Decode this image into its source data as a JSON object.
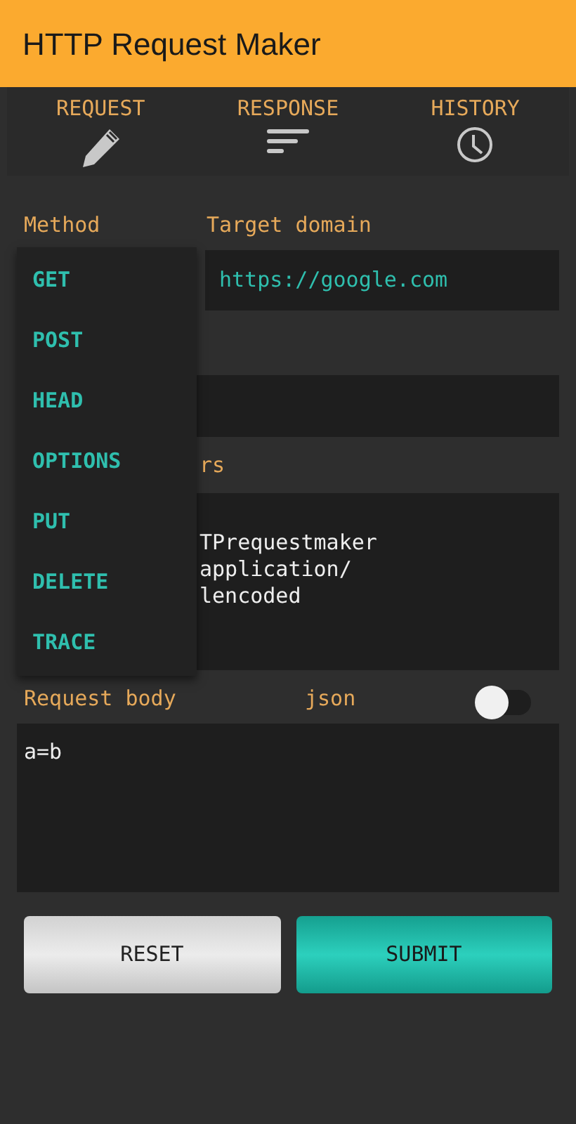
{
  "app_bar": {
    "title": "HTTP Request Maker"
  },
  "tabs": [
    {
      "label": "REQUEST",
      "kind": "pencil"
    },
    {
      "label": "RESPONSE",
      "kind": "lines"
    },
    {
      "label": "HISTORY",
      "kind": "clock"
    }
  ],
  "form": {
    "method_label": "Method",
    "domain_label": "Target domain",
    "domain_value": "https://google.com",
    "headers_label_partial": "rs",
    "headers_value_partial": [
      "TPrequestmaker",
      "application/",
      "lencoded"
    ],
    "body_label": "Request body",
    "json_label": "json",
    "json_on": false,
    "body_value": "a=b"
  },
  "method_menu": [
    "GET",
    "POST",
    "HEAD",
    "OPTIONS",
    "PUT",
    "DELETE",
    "TRACE"
  ],
  "buttons": {
    "reset": "RESET",
    "submit": "SUBMIT"
  }
}
